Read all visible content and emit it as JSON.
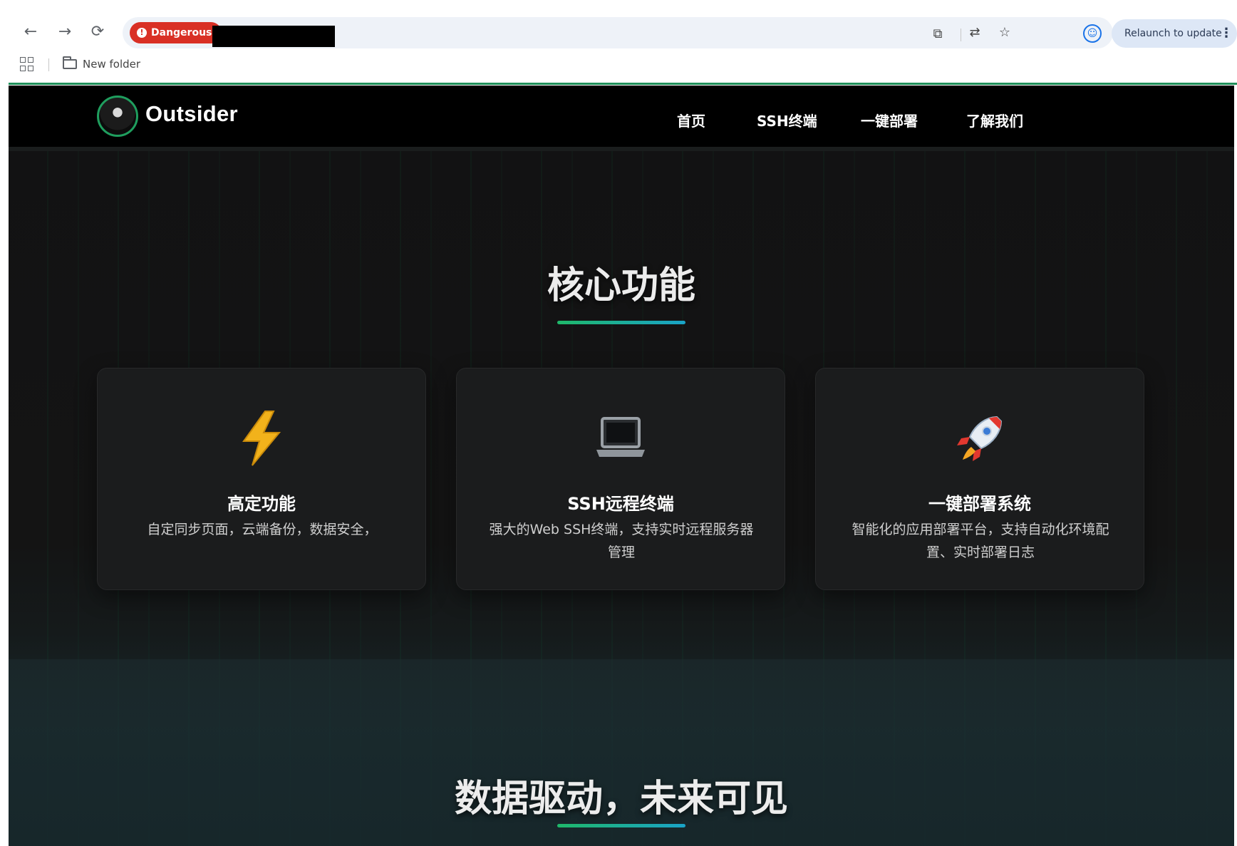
{
  "browser": {
    "security_chip": "Dangerous",
    "relaunch_label": "Relaunch to update",
    "bookmark_folder": "New folder"
  },
  "site": {
    "brand": "Outsider",
    "nav": [
      "首页",
      "SSH终端",
      "一键部署",
      "了解我们"
    ]
  },
  "features": {
    "title": "核心功能",
    "cards": [
      {
        "icon": "lightning-icon",
        "title": "高定功能",
        "desc": "自定同步页面，云端备份，数据安全，"
      },
      {
        "icon": "laptop-icon",
        "title": "SSH远程终端",
        "desc": "强大的Web SSH终端，支持实时远程服务器管理"
      },
      {
        "icon": "rocket-icon",
        "title": "一键部署系统",
        "desc": "智能化的应用部署平台，支持自动化环境配置、实时部署日志"
      }
    ]
  },
  "data_section": {
    "title": "数据驱动，未来可见"
  },
  "colors": {
    "accent_green": "#1fb86a",
    "accent_cyan": "#1aa3c8",
    "danger_red": "#d93025"
  }
}
